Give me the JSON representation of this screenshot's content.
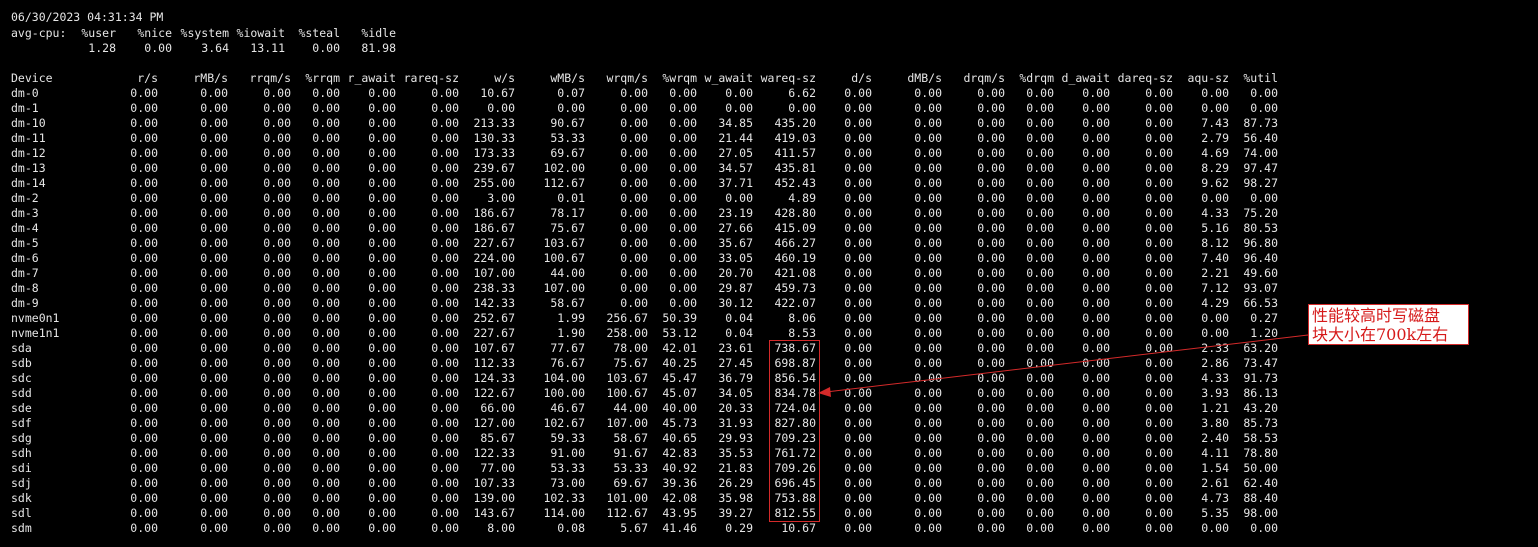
{
  "timestamp": "06/30/2023 04:31:34 PM",
  "cpu": {
    "label": "avg-cpu:",
    "headers": [
      "%user",
      "%nice",
      "%system",
      "%iowait",
      "%steal",
      "%idle"
    ],
    "values": [
      "1.28",
      "0.00",
      "3.64",
      "13.11",
      "0.00",
      "81.98"
    ]
  },
  "device_table": {
    "headers": [
      "Device",
      "r/s",
      "rMB/s",
      "rrqm/s",
      "%rrqm",
      "r_await",
      "rareq-sz",
      "w/s",
      "wMB/s",
      "wrqm/s",
      "%wrqm",
      "w_await",
      "wareq-sz",
      "d/s",
      "dMB/s",
      "drqm/s",
      "%drqm",
      "d_await",
      "dareq-sz",
      "aqu-sz",
      "%util"
    ],
    "rows": [
      [
        "dm-0",
        "0.00",
        "0.00",
        "0.00",
        "0.00",
        "0.00",
        "0.00",
        "10.67",
        "0.07",
        "0.00",
        "0.00",
        "0.00",
        "6.62",
        "0.00",
        "0.00",
        "0.00",
        "0.00",
        "0.00",
        "0.00",
        "0.00",
        "0.00"
      ],
      [
        "dm-1",
        "0.00",
        "0.00",
        "0.00",
        "0.00",
        "0.00",
        "0.00",
        "0.00",
        "0.00",
        "0.00",
        "0.00",
        "0.00",
        "0.00",
        "0.00",
        "0.00",
        "0.00",
        "0.00",
        "0.00",
        "0.00",
        "0.00",
        "0.00"
      ],
      [
        "dm-10",
        "0.00",
        "0.00",
        "0.00",
        "0.00",
        "0.00",
        "0.00",
        "213.33",
        "90.67",
        "0.00",
        "0.00",
        "34.85",
        "435.20",
        "0.00",
        "0.00",
        "0.00",
        "0.00",
        "0.00",
        "0.00",
        "7.43",
        "87.73"
      ],
      [
        "dm-11",
        "0.00",
        "0.00",
        "0.00",
        "0.00",
        "0.00",
        "0.00",
        "130.33",
        "53.33",
        "0.00",
        "0.00",
        "21.44",
        "419.03",
        "0.00",
        "0.00",
        "0.00",
        "0.00",
        "0.00",
        "0.00",
        "2.79",
        "56.40"
      ],
      [
        "dm-12",
        "0.00",
        "0.00",
        "0.00",
        "0.00",
        "0.00",
        "0.00",
        "173.33",
        "69.67",
        "0.00",
        "0.00",
        "27.05",
        "411.57",
        "0.00",
        "0.00",
        "0.00",
        "0.00",
        "0.00",
        "0.00",
        "4.69",
        "74.00"
      ],
      [
        "dm-13",
        "0.00",
        "0.00",
        "0.00",
        "0.00",
        "0.00",
        "0.00",
        "239.67",
        "102.00",
        "0.00",
        "0.00",
        "34.57",
        "435.81",
        "0.00",
        "0.00",
        "0.00",
        "0.00",
        "0.00",
        "0.00",
        "8.29",
        "97.47"
      ],
      [
        "dm-14",
        "0.00",
        "0.00",
        "0.00",
        "0.00",
        "0.00",
        "0.00",
        "255.00",
        "112.67",
        "0.00",
        "0.00",
        "37.71",
        "452.43",
        "0.00",
        "0.00",
        "0.00",
        "0.00",
        "0.00",
        "0.00",
        "9.62",
        "98.27"
      ],
      [
        "dm-2",
        "0.00",
        "0.00",
        "0.00",
        "0.00",
        "0.00",
        "0.00",
        "3.00",
        "0.01",
        "0.00",
        "0.00",
        "0.00",
        "4.89",
        "0.00",
        "0.00",
        "0.00",
        "0.00",
        "0.00",
        "0.00",
        "0.00",
        "0.00"
      ],
      [
        "dm-3",
        "0.00",
        "0.00",
        "0.00",
        "0.00",
        "0.00",
        "0.00",
        "186.67",
        "78.17",
        "0.00",
        "0.00",
        "23.19",
        "428.80",
        "0.00",
        "0.00",
        "0.00",
        "0.00",
        "0.00",
        "0.00",
        "4.33",
        "75.20"
      ],
      [
        "dm-4",
        "0.00",
        "0.00",
        "0.00",
        "0.00",
        "0.00",
        "0.00",
        "186.67",
        "75.67",
        "0.00",
        "0.00",
        "27.66",
        "415.09",
        "0.00",
        "0.00",
        "0.00",
        "0.00",
        "0.00",
        "0.00",
        "5.16",
        "80.53"
      ],
      [
        "dm-5",
        "0.00",
        "0.00",
        "0.00",
        "0.00",
        "0.00",
        "0.00",
        "227.67",
        "103.67",
        "0.00",
        "0.00",
        "35.67",
        "466.27",
        "0.00",
        "0.00",
        "0.00",
        "0.00",
        "0.00",
        "0.00",
        "8.12",
        "96.80"
      ],
      [
        "dm-6",
        "0.00",
        "0.00",
        "0.00",
        "0.00",
        "0.00",
        "0.00",
        "224.00",
        "100.67",
        "0.00",
        "0.00",
        "33.05",
        "460.19",
        "0.00",
        "0.00",
        "0.00",
        "0.00",
        "0.00",
        "0.00",
        "7.40",
        "96.40"
      ],
      [
        "dm-7",
        "0.00",
        "0.00",
        "0.00",
        "0.00",
        "0.00",
        "0.00",
        "107.00",
        "44.00",
        "0.00",
        "0.00",
        "20.70",
        "421.08",
        "0.00",
        "0.00",
        "0.00",
        "0.00",
        "0.00",
        "0.00",
        "2.21",
        "49.60"
      ],
      [
        "dm-8",
        "0.00",
        "0.00",
        "0.00",
        "0.00",
        "0.00",
        "0.00",
        "238.33",
        "107.00",
        "0.00",
        "0.00",
        "29.87",
        "459.73",
        "0.00",
        "0.00",
        "0.00",
        "0.00",
        "0.00",
        "0.00",
        "7.12",
        "93.07"
      ],
      [
        "dm-9",
        "0.00",
        "0.00",
        "0.00",
        "0.00",
        "0.00",
        "0.00",
        "142.33",
        "58.67",
        "0.00",
        "0.00",
        "30.12",
        "422.07",
        "0.00",
        "0.00",
        "0.00",
        "0.00",
        "0.00",
        "0.00",
        "4.29",
        "66.53"
      ],
      [
        "nvme0n1",
        "0.00",
        "0.00",
        "0.00",
        "0.00",
        "0.00",
        "0.00",
        "252.67",
        "1.99",
        "256.67",
        "50.39",
        "0.04",
        "8.06",
        "0.00",
        "0.00",
        "0.00",
        "0.00",
        "0.00",
        "0.00",
        "0.00",
        "0.27"
      ],
      [
        "nvme1n1",
        "0.00",
        "0.00",
        "0.00",
        "0.00",
        "0.00",
        "0.00",
        "227.67",
        "1.90",
        "258.00",
        "53.12",
        "0.04",
        "8.53",
        "0.00",
        "0.00",
        "0.00",
        "0.00",
        "0.00",
        "0.00",
        "0.00",
        "1.20"
      ],
      [
        "sda",
        "0.00",
        "0.00",
        "0.00",
        "0.00",
        "0.00",
        "0.00",
        "107.67",
        "77.67",
        "78.00",
        "42.01",
        "23.61",
        "738.67",
        "0.00",
        "0.00",
        "0.00",
        "0.00",
        "0.00",
        "0.00",
        "2.33",
        "63.20"
      ],
      [
        "sdb",
        "0.00",
        "0.00",
        "0.00",
        "0.00",
        "0.00",
        "0.00",
        "112.33",
        "76.67",
        "75.67",
        "40.25",
        "27.45",
        "698.87",
        "0.00",
        "0.00",
        "0.00",
        "0.00",
        "0.00",
        "0.00",
        "2.86",
        "73.47"
      ],
      [
        "sdc",
        "0.00",
        "0.00",
        "0.00",
        "0.00",
        "0.00",
        "0.00",
        "124.33",
        "104.00",
        "103.67",
        "45.47",
        "36.79",
        "856.54",
        "0.00",
        "0.00",
        "0.00",
        "0.00",
        "0.00",
        "0.00",
        "4.33",
        "91.73"
      ],
      [
        "sdd",
        "0.00",
        "0.00",
        "0.00",
        "0.00",
        "0.00",
        "0.00",
        "122.67",
        "100.00",
        "100.67",
        "45.07",
        "34.05",
        "834.78",
        "0.00",
        "0.00",
        "0.00",
        "0.00",
        "0.00",
        "0.00",
        "3.93",
        "86.13"
      ],
      [
        "sde",
        "0.00",
        "0.00",
        "0.00",
        "0.00",
        "0.00",
        "0.00",
        "66.00",
        "46.67",
        "44.00",
        "40.00",
        "20.33",
        "724.04",
        "0.00",
        "0.00",
        "0.00",
        "0.00",
        "0.00",
        "0.00",
        "1.21",
        "43.20"
      ],
      [
        "sdf",
        "0.00",
        "0.00",
        "0.00",
        "0.00",
        "0.00",
        "0.00",
        "127.00",
        "102.67",
        "107.00",
        "45.73",
        "31.93",
        "827.80",
        "0.00",
        "0.00",
        "0.00",
        "0.00",
        "0.00",
        "0.00",
        "3.80",
        "85.73"
      ],
      [
        "sdg",
        "0.00",
        "0.00",
        "0.00",
        "0.00",
        "0.00",
        "0.00",
        "85.67",
        "59.33",
        "58.67",
        "40.65",
        "29.93",
        "709.23",
        "0.00",
        "0.00",
        "0.00",
        "0.00",
        "0.00",
        "0.00",
        "2.40",
        "58.53"
      ],
      [
        "sdh",
        "0.00",
        "0.00",
        "0.00",
        "0.00",
        "0.00",
        "0.00",
        "122.33",
        "91.00",
        "91.67",
        "42.83",
        "35.53",
        "761.72",
        "0.00",
        "0.00",
        "0.00",
        "0.00",
        "0.00",
        "0.00",
        "4.11",
        "78.80"
      ],
      [
        "sdi",
        "0.00",
        "0.00",
        "0.00",
        "0.00",
        "0.00",
        "0.00",
        "77.00",
        "53.33",
        "53.33",
        "40.92",
        "21.83",
        "709.26",
        "0.00",
        "0.00",
        "0.00",
        "0.00",
        "0.00",
        "0.00",
        "1.54",
        "50.00"
      ],
      [
        "sdj",
        "0.00",
        "0.00",
        "0.00",
        "0.00",
        "0.00",
        "0.00",
        "107.33",
        "73.00",
        "69.67",
        "39.36",
        "26.29",
        "696.45",
        "0.00",
        "0.00",
        "0.00",
        "0.00",
        "0.00",
        "0.00",
        "2.61",
        "62.40"
      ],
      [
        "sdk",
        "0.00",
        "0.00",
        "0.00",
        "0.00",
        "0.00",
        "0.00",
        "139.00",
        "102.33",
        "101.00",
        "42.08",
        "35.98",
        "753.88",
        "0.00",
        "0.00",
        "0.00",
        "0.00",
        "0.00",
        "0.00",
        "4.73",
        "88.40"
      ],
      [
        "sdl",
        "0.00",
        "0.00",
        "0.00",
        "0.00",
        "0.00",
        "0.00",
        "143.67",
        "114.00",
        "112.67",
        "43.95",
        "39.27",
        "812.55",
        "0.00",
        "0.00",
        "0.00",
        "0.00",
        "0.00",
        "0.00",
        "5.35",
        "98.00"
      ],
      [
        "sdm",
        "0.00",
        "0.00",
        "0.00",
        "0.00",
        "0.00",
        "0.00",
        "8.00",
        "0.08",
        "5.67",
        "41.46",
        "0.29",
        "10.67",
        "0.00",
        "0.00",
        "0.00",
        "0.00",
        "0.00",
        "0.00",
        "0.00",
        "0.00"
      ]
    ]
  },
  "annotation": {
    "line1": "性能较高时写磁盘",
    "line2": "块大小在700k左右",
    "color": "#d42a2a"
  }
}
